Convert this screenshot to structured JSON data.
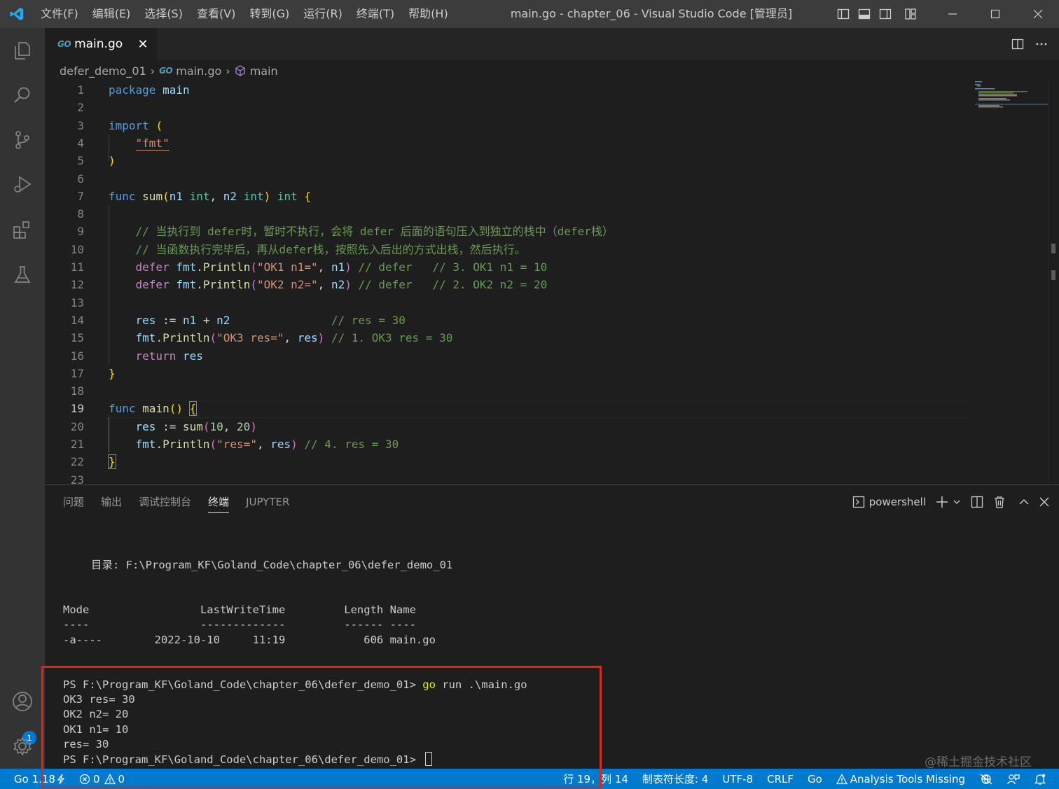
{
  "window": {
    "title": "main.go - chapter_06 - Visual Studio Code [管理员]",
    "menu": [
      "文件(F)",
      "编辑(E)",
      "选择(S)",
      "查看(V)",
      "转到(G)",
      "运行(R)",
      "终端(T)",
      "帮助(H)"
    ]
  },
  "activity": {
    "badge": "1"
  },
  "tab": {
    "go_badge": "GO",
    "label": "main.go",
    "close": "✕"
  },
  "breadcrumb": {
    "folder": "defer_demo_01",
    "go_badge": "GO",
    "file": "main.go",
    "symbol": "main"
  },
  "editor": {
    "line_numbers": [
      "1",
      "2",
      "3",
      "4",
      "5",
      "6",
      "7",
      "8",
      "9",
      "10",
      "11",
      "12",
      "13",
      "14",
      "15",
      "16",
      "17",
      "18",
      "19",
      "20",
      "21",
      "22",
      "23"
    ],
    "active_line": "19",
    "code": {
      "l1": [
        "package",
        " ",
        "main"
      ],
      "l3": [
        "import",
        " ",
        "("
      ],
      "l4": [
        "\"fmt\""
      ],
      "l5": [
        ")"
      ],
      "l7": [
        "func",
        " ",
        "sum",
        "(",
        "n1",
        " ",
        "int",
        ", ",
        "n2",
        " ",
        "int",
        ")",
        " ",
        "int",
        " ",
        "{"
      ],
      "l9": [
        "// 当执行到 defer时，暂时不执行，会将 defer 后面的语句压入到独立的栈中（defer栈）"
      ],
      "l10": [
        "// 当函数执行完毕后，再从defer栈，按照先入后出的方式出栈，然后执行。"
      ],
      "l11": [
        "defer",
        " ",
        "fmt",
        ".",
        "Println",
        "(",
        "\"OK1 n1=\"",
        ", ",
        "n1",
        ")",
        " ",
        "// defer   // 3. OK1 n1 = 10"
      ],
      "l12": [
        "defer",
        " ",
        "fmt",
        ".",
        "Println",
        "(",
        "\"OK2 n2=\"",
        ", ",
        "n2",
        ")",
        " ",
        "// defer   // 2. OK2 n2 = 20"
      ],
      "l14": [
        "res",
        " := ",
        "n1",
        " + ",
        "n2",
        "               ",
        "// res = 30"
      ],
      "l15": [
        "fmt",
        ".",
        "Println",
        "(",
        "\"OK3 res=\"",
        ", ",
        "res",
        ")",
        " ",
        "// 1. OK3 res = 30"
      ],
      "l16": [
        "return",
        " ",
        "res"
      ],
      "l17": [
        "}"
      ],
      "l19": [
        "func",
        " ",
        "main",
        "()",
        " ",
        "{"
      ],
      "l20": [
        "res",
        " := ",
        "sum",
        "(",
        "10",
        ", ",
        "20",
        ")"
      ],
      "l21": [
        "fmt",
        ".",
        "Println",
        "(",
        "\"res=\"",
        ", ",
        "res",
        ")",
        " ",
        "// 4. res = 30"
      ],
      "l22": [
        "}"
      ]
    }
  },
  "panel": {
    "tabs": [
      "问题",
      "输出",
      "调试控制台",
      "终端",
      "JUPYTER"
    ],
    "active_tab": "终端",
    "shell": "powershell",
    "terminal": {
      "dir_line": "目录: F:\\Program_KF\\Goland_Code\\chapter_06\\defer_demo_01",
      "header_line": "Mode                 LastWriteTime         Length Name",
      "dash_line": "----                 -------------         ------ ----",
      "file_line": "-a----        2022-10-10     11:19            606 main.go",
      "prompt1": "PS F:\\Program_KF\\Goland_Code\\chapter_06\\defer_demo_01> ",
      "cmd_kw": "go",
      "cmd_rest": " run .\\main.go",
      "out1": "OK3 res= 30",
      "out2": "OK2 n2= 20",
      "out3": "OK1 n1= 10",
      "out4": "res= 30",
      "prompt2": "PS F:\\Program_KF\\Goland_Code\\chapter_06\\defer_demo_01> "
    }
  },
  "statusbar": {
    "go_version": "Go 1.18",
    "errors": "0",
    "warnings": "0",
    "position": "行 19，列 14",
    "tab_size": "制表符长度: 4",
    "encoding": "UTF-8",
    "eol": "CRLF",
    "language": "Go",
    "analysis": "Analysis Tools Missing"
  },
  "watermark": "@稀土掘金技术社区",
  "colors": {
    "statusbar": "#007acc",
    "highlight_box": "#e0241b",
    "activitybar": "#333333",
    "titlebar": "#3c3c3c"
  }
}
